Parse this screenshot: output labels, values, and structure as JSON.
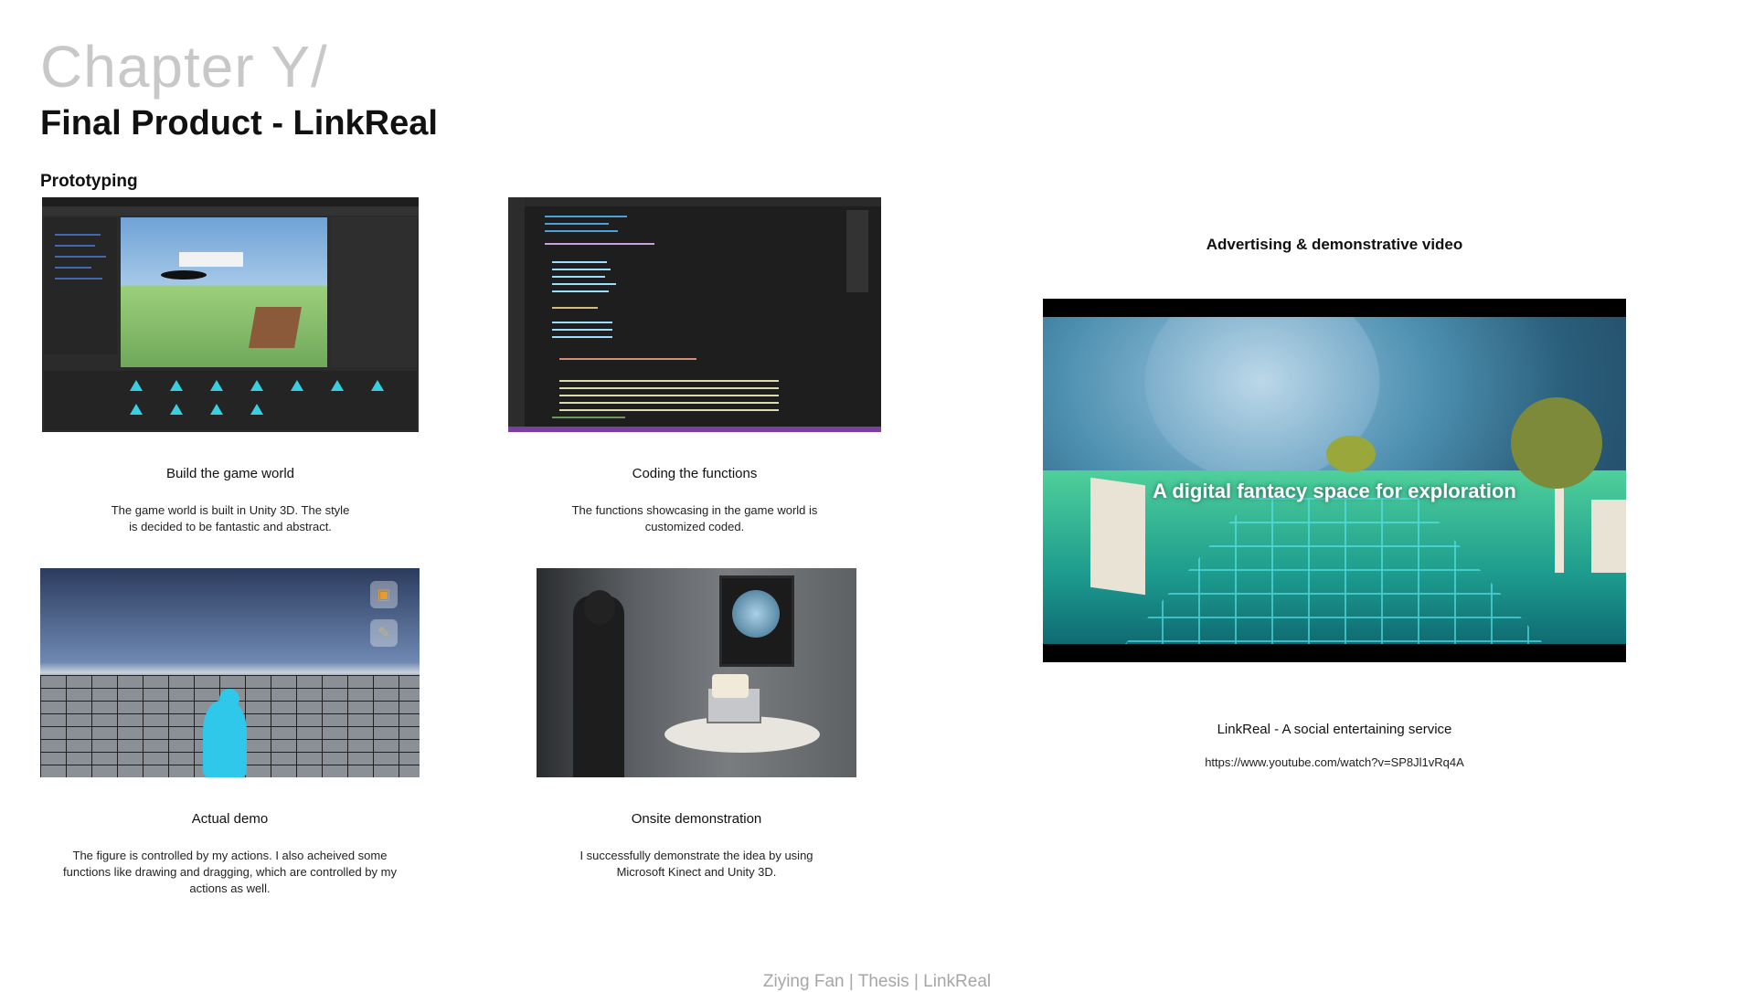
{
  "header": {
    "chapter": "Chapter Y/",
    "title": "Final Product - LinkReal"
  },
  "section_label": "Prototyping",
  "cards": [
    {
      "caption": "Build the game world",
      "description_lines": [
        "The game world is built in Unity 3D. The style",
        "is decided to be fantastic and abstract."
      ]
    },
    {
      "caption": "Coding the functions",
      "description_lines": [
        "The functions showcasing in the game world is",
        "customized coded."
      ]
    },
    {
      "caption": "Actual demo",
      "description_lines": [
        "The figure is controlled by my actions. I also acheived some",
        "functions like drawing and dragging, which are controlled by my",
        "actions as well."
      ]
    },
    {
      "caption": "Onsite demonstration",
      "description_lines": [
        "I successfully demonstrate the idea by using",
        "Microsoft Kinect and Unity 3D."
      ]
    }
  ],
  "video": {
    "heading": "Advertising & demonstrative video",
    "overlay_text": "A digital fantacy space for exploration",
    "caption": "LinkReal - A social entertaining service",
    "url": "https://www.youtube.com/watch?v=SP8Jl1vRq4A"
  },
  "demo_icons": [
    "image-icon",
    "brush-icon"
  ],
  "footer": "Ziying Fan | Thesis | LinkReal"
}
